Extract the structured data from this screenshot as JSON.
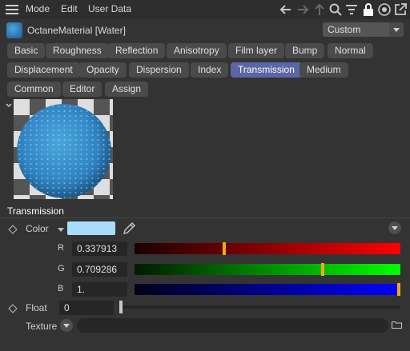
{
  "menubar": {
    "items": [
      "Mode",
      "Edit",
      "User Data"
    ]
  },
  "toolbar_icons": [
    "back-arrow-icon",
    "forward-arrow-icon",
    "up-arrow-icon",
    "search-icon",
    "filter-icon",
    "lock-icon",
    "target-icon",
    "external-link-icon"
  ],
  "header": {
    "title": "OctaneMaterial [Water]",
    "preset": "Custom"
  },
  "tabs": [
    {
      "label": "Basic"
    },
    {
      "label": "Roughness"
    },
    {
      "label": "Reflection"
    },
    {
      "label": "Anisotropy"
    },
    {
      "label": "Film layer"
    },
    {
      "label": "Bump"
    },
    {
      "label": "Normal"
    },
    {
      "label": "Displacement"
    },
    {
      "label": "Opacity"
    },
    {
      "label": "Dispersion"
    },
    {
      "label": "Index"
    },
    {
      "label": "Transmission"
    },
    {
      "label": "Medium"
    },
    {
      "label": "Common"
    },
    {
      "label": "Editor"
    },
    {
      "label": "Assign"
    }
  ],
  "active_tab": "Transmission",
  "section": {
    "title": "Transmission",
    "color_label": "Color",
    "color_value": "#a8dcfb",
    "channels": [
      {
        "name": "R",
        "value": "0.337913",
        "fraction": 0.337913
      },
      {
        "name": "G",
        "value": "0.709286",
        "fraction": 0.709286
      },
      {
        "name": "B",
        "value": "1.",
        "fraction": 1.0
      }
    ],
    "float_label": "Float",
    "float_value": "0",
    "texture_label": "Texture"
  }
}
